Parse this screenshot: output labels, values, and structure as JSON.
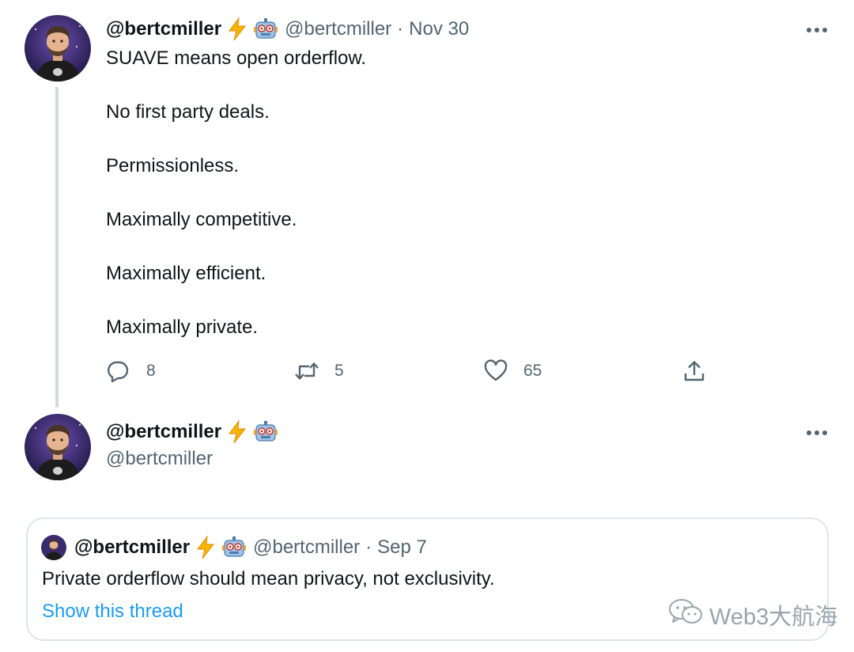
{
  "tweet1": {
    "name": "@bertcmiller",
    "handle": "@bertcmiller",
    "separator": "·",
    "date": "Nov 30",
    "lines": [
      "SUAVE means open orderflow.",
      "No first party deals.",
      "Permissionless.",
      "Maximally competitive.",
      "Maximally efficient.",
      "Maximally private."
    ],
    "actions": {
      "replies": "8",
      "retweets": "5",
      "likes": "65"
    }
  },
  "tweet2": {
    "name": "@bertcmiller",
    "handle": "@bertcmiller"
  },
  "quote": {
    "name": "@bertcmiller",
    "handle": "@bertcmiller",
    "separator": "·",
    "date": "Sep 7",
    "text": "Private orderflow should mean privacy, not exclusivity.",
    "show_thread": "Show this thread"
  },
  "watermark": {
    "text": "Web3大航海"
  },
  "icons": {
    "name_emoji_1": "lightning-bolt-icon",
    "name_emoji_2": "robot-face-icon",
    "reply": "reply-icon",
    "retweet": "retweet-icon",
    "like": "heart-icon",
    "share": "share-icon",
    "more": "more-options-icon",
    "watermark": "wechat-icon"
  },
  "colors": {
    "link": "#1d9bf0",
    "secondary_text": "#536471",
    "thread_line": "#cfd9de",
    "card_border": "#dfe5ea"
  }
}
